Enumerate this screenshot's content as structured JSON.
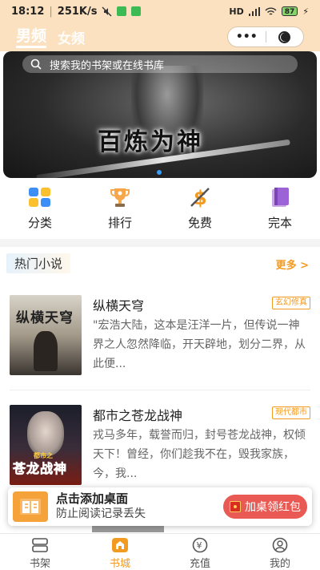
{
  "status": {
    "time": "18:12",
    "net_speed": "251K/s",
    "signal": "HD",
    "battery": "87"
  },
  "header": {
    "tab_male": "男频",
    "tab_female": "女频",
    "more_dots": "•••"
  },
  "banner": {
    "search_placeholder": "搜索我的书架或在线书库",
    "title": "百炼为神"
  },
  "categories": [
    {
      "label": "分类",
      "icon": "grid-icon"
    },
    {
      "label": "排行",
      "icon": "trophy-icon"
    },
    {
      "label": "免费",
      "icon": "dollar-icon"
    },
    {
      "label": "完本",
      "icon": "books-icon"
    }
  ],
  "section": {
    "title": "热门小说",
    "more": "更多 >"
  },
  "books": [
    {
      "title": "纵横天穹",
      "tag": "玄幻修真",
      "desc": "\"宏浩大陆，这本是汪洋一片，但传说一神界之人忽然降临，开天辟地，划分二界，从此便...",
      "cover_text": "纵横天穹"
    },
    {
      "title": "都市之苍龙战神",
      "tag": "现代都市",
      "desc": "戎马多年，载誉而归，封号苍龙战神，权倾天下！曾经，你们趁我不在，毁我家族，今，我...",
      "cover_text": "苍龙战神",
      "cover_top": "都市之"
    }
  ],
  "popup": {
    "line1": "点击添加桌面",
    "line2": "防止阅读记录丢失",
    "button": "加桌领红包"
  },
  "nav": [
    {
      "label": "书架",
      "icon": "bookshelf-icon"
    },
    {
      "label": "书城",
      "icon": "store-icon"
    },
    {
      "label": "充值",
      "icon": "yuan-icon"
    },
    {
      "label": "我的",
      "icon": "user-icon"
    }
  ],
  "colors": {
    "accent": "#f39a20",
    "header_bg": "#fbe1bf",
    "popup_button": "#e85a53"
  }
}
